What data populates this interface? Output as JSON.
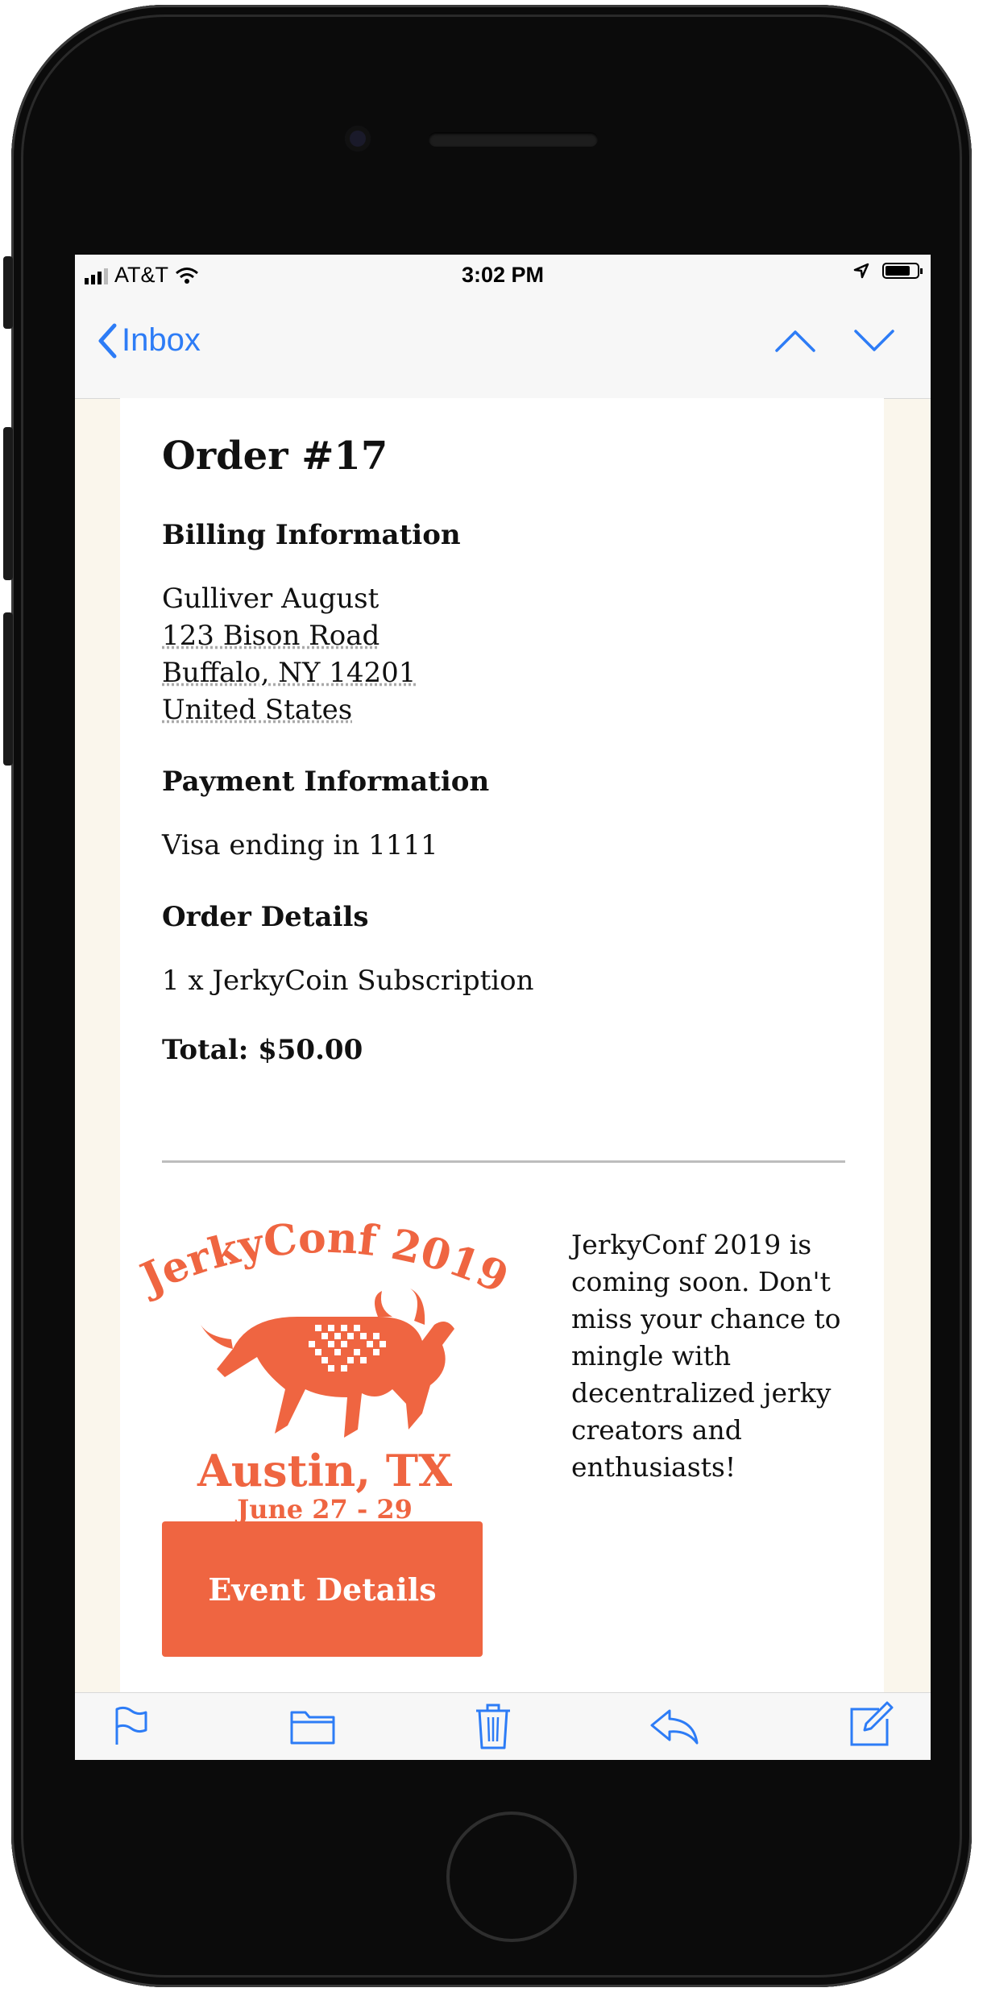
{
  "status_bar": {
    "carrier": "AT&T",
    "time": "3:02 PM"
  },
  "nav": {
    "back_label": "Inbox"
  },
  "email": {
    "title": "Order #17",
    "billing": {
      "heading": "Billing Information",
      "name": "Gulliver August",
      "street": "123 Bison Road",
      "city": "Buffalo, NY 14201",
      "country": "United States"
    },
    "payment": {
      "heading": "Payment Information",
      "text": "Visa ending in 1111"
    },
    "order": {
      "heading": "Order Details",
      "item": "1 x JerkyCoin Subscription",
      "total": "Total: $50.00"
    },
    "promo": {
      "logo_title": "JerkyConf 2019",
      "logo_city": "Austin, TX",
      "logo_dates": "June 27 - 29",
      "text": "JerkyConf 2019 is coming soon. Don't miss your chance to mingle with decentralized jerky creators and enthusiasts!",
      "cta_label": "Event Details"
    }
  },
  "colors": {
    "accent": "#ef6541",
    "link": "#2d7cf6",
    "background": "#faf6ec"
  },
  "icons": [
    "signal-icon",
    "wifi-icon",
    "location-icon",
    "battery-icon",
    "back-chevron-icon",
    "chevron-up-icon",
    "chevron-down-icon",
    "flag-icon",
    "folder-icon",
    "trash-icon",
    "reply-icon",
    "compose-icon"
  ]
}
